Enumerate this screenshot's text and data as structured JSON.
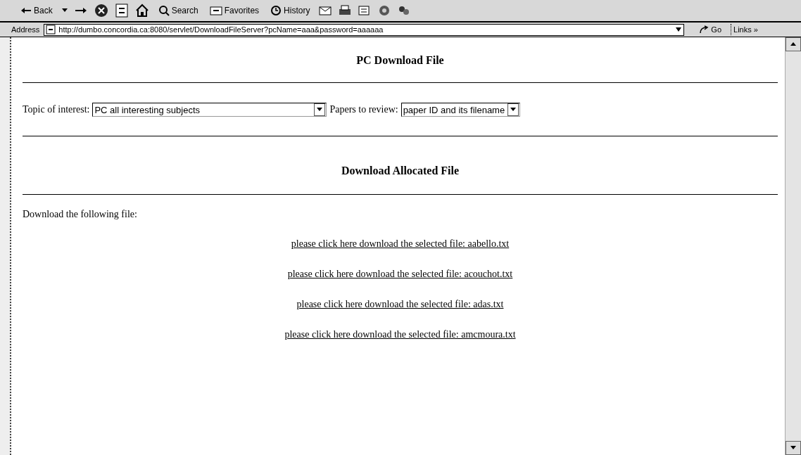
{
  "toolbar": {
    "back": "Back",
    "search": "Search",
    "favorites": "Favorites",
    "history": "History"
  },
  "address_bar": {
    "label": "Address",
    "url": "http://dumbo.concordia.ca:8080/servlet/DownloadFileServer?pcName=aaa&password=aaaaaa",
    "go": "Go",
    "links": "Links »"
  },
  "page": {
    "title": "PC Download File",
    "topic": {
      "label": "Topic of interest:",
      "value": "PC all interesting subjects"
    },
    "papers": {
      "label": "Papers to review:",
      "value": "paper ID and its filename"
    },
    "section_title": "Download Allocated File",
    "intro": "Download the following file:",
    "links": [
      "please click here download the selected file: aabello.txt",
      "please click here download the selected file: acouchot.txt",
      "please click here download the selected file: adas.txt",
      "please click here download the selected file: amcmoura.txt"
    ]
  }
}
